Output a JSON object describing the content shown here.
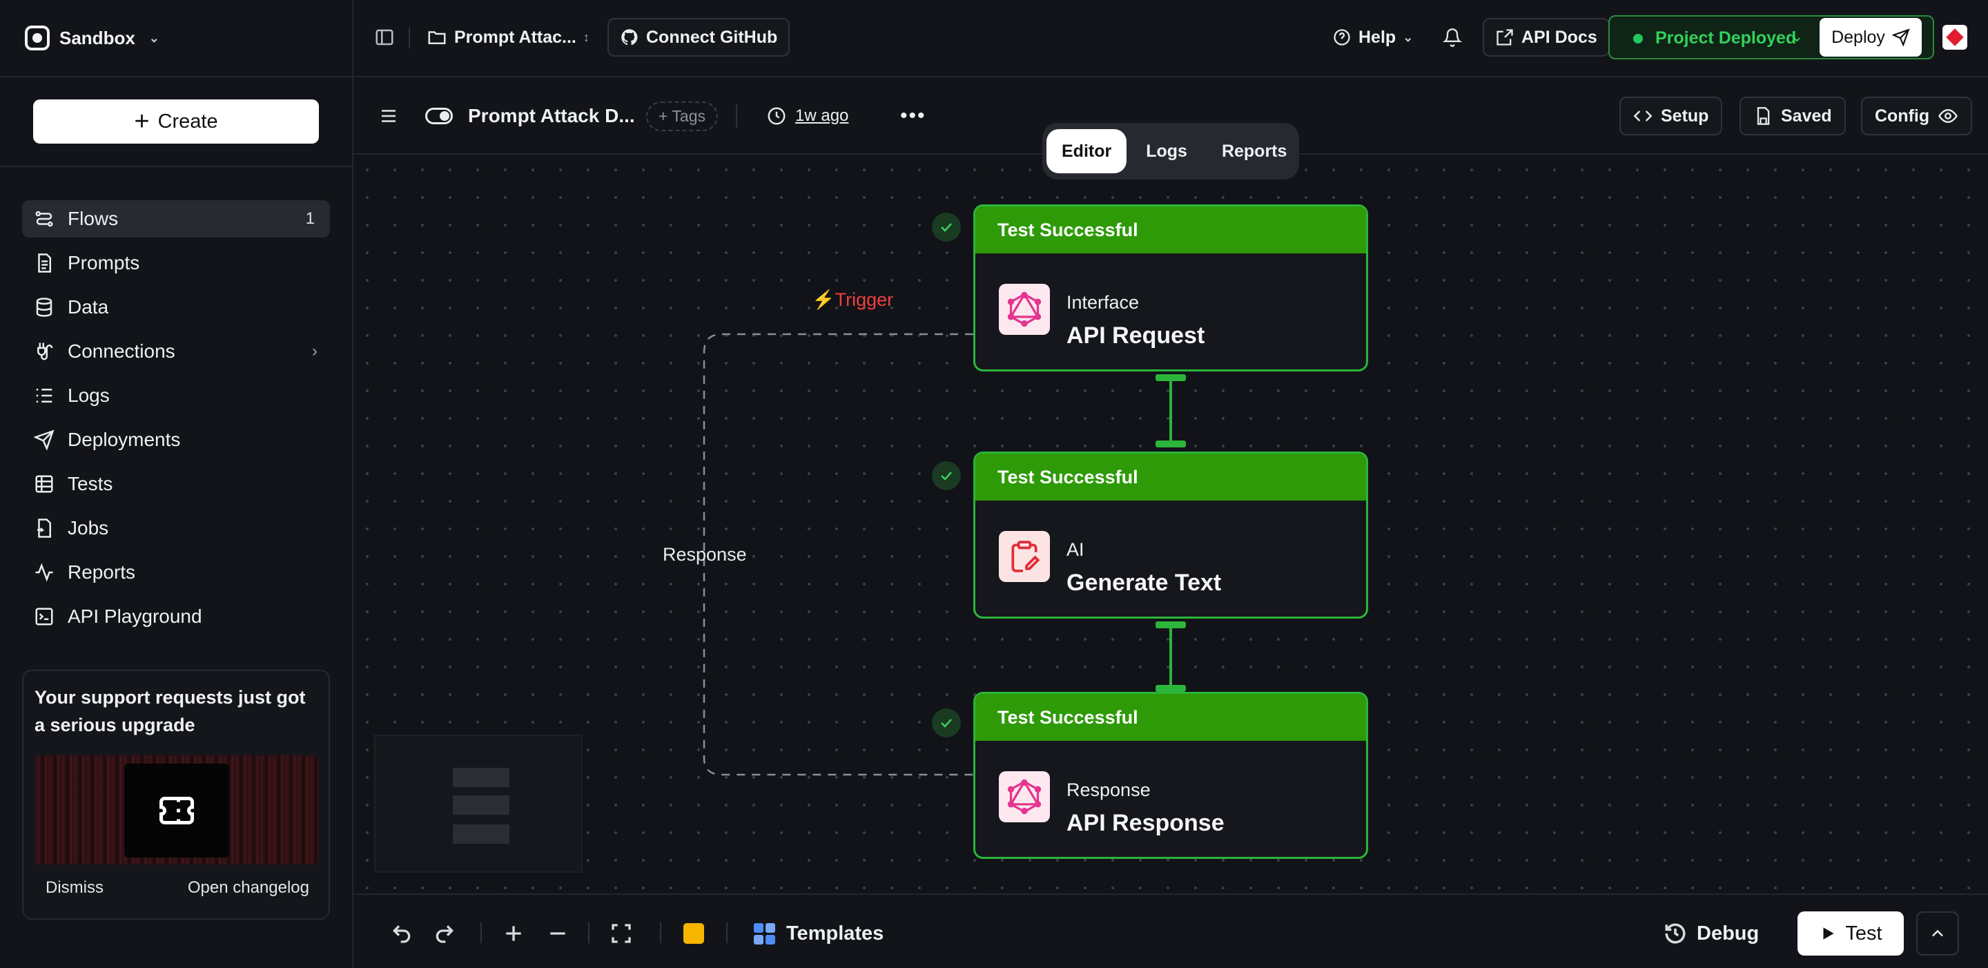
{
  "workspace": {
    "name": "Sandbox"
  },
  "sidebar": {
    "create_label": "Create",
    "items": [
      {
        "label": "Flows",
        "icon": "flows-icon",
        "count": "1",
        "active": true
      },
      {
        "label": "Prompts",
        "icon": "document-icon"
      },
      {
        "label": "Data",
        "icon": "database-icon"
      },
      {
        "label": "Connections",
        "icon": "plug-icon"
      },
      {
        "label": "Logs",
        "icon": "list-icon"
      },
      {
        "label": "Deployments",
        "icon": "send-icon"
      },
      {
        "label": "Tests",
        "icon": "table-icon"
      },
      {
        "label": "Jobs",
        "icon": "file-icon"
      },
      {
        "label": "Reports",
        "icon": "activity-icon"
      },
      {
        "label": "API Playground",
        "icon": "terminal-icon"
      }
    ],
    "promo": {
      "title": "Your support requests just got a serious upgrade",
      "dismiss": "Dismiss",
      "open": "Open changelog"
    }
  },
  "topbar": {
    "project": "Prompt Attac...",
    "connect_github": "Connect GitHub",
    "help": "Help",
    "api_docs": "API Docs",
    "status": "Project Deployed",
    "deploy": "Deploy"
  },
  "subbar": {
    "flow_name": "Prompt Attack D...",
    "tags": "+ Tags",
    "updated": "1w ago",
    "setup": "Setup",
    "saved": "Saved",
    "config": "Config"
  },
  "tabs": [
    {
      "label": "Editor",
      "active": true
    },
    {
      "label": "Logs"
    },
    {
      "label": "Reports"
    }
  ],
  "nodes": [
    {
      "status": "Test Successful",
      "kind": "Interface",
      "name": "API Request",
      "icon": "graphql-icon"
    },
    {
      "status": "Test Successful",
      "kind": "AI",
      "name": "Generate Text",
      "icon": "clipboard-pen-icon"
    },
    {
      "status": "Test Successful",
      "kind": "Response",
      "name": "API Response",
      "icon": "graphql-icon"
    }
  ],
  "edges": {
    "trigger_label": "⚡Trigger",
    "response_label": "Response"
  },
  "bottombar": {
    "templates": "Templates",
    "debug": "Debug",
    "test": "Test"
  },
  "colors": {
    "success": "#2e9a08",
    "node_border": "#2bb53a",
    "trigger": "#f23f3f",
    "deployed": "#34d15a"
  }
}
